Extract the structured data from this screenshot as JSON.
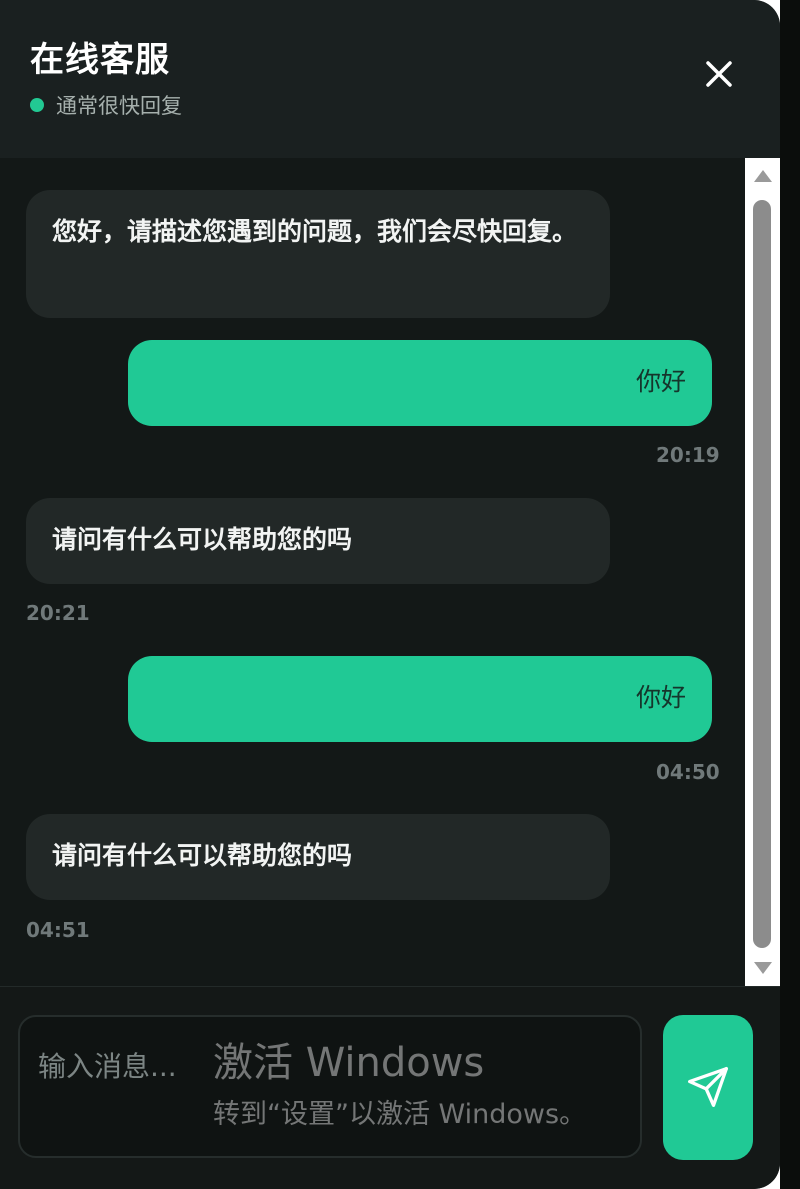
{
  "header": {
    "title": "在线客服",
    "status_text": "通常很快回复"
  },
  "icons": {
    "close": "close-icon",
    "send": "send-icon",
    "status": "online-dot-icon"
  },
  "messages": [
    {
      "from": "agent",
      "text": "您好，请描述您遇到的问题，我们会尽快回复。",
      "time": ""
    },
    {
      "from": "user",
      "text": "你好",
      "time": "20:19"
    },
    {
      "from": "agent",
      "text": "请问有什么可以帮助您的吗",
      "time": "20:21"
    },
    {
      "from": "user",
      "text": "你好",
      "time": "04:50"
    },
    {
      "from": "agent",
      "text": "请问有什么可以帮助您的吗",
      "time": "04:51"
    }
  ],
  "input": {
    "placeholder": "输入消息..."
  },
  "watermark": {
    "title": "激活 Windows",
    "subtitle": "转到“设置”以激活 Windows。"
  },
  "colors": {
    "accent": "#20c995",
    "background": "#141817",
    "agent_bubble": "#222827",
    "header": "#1a2020"
  }
}
